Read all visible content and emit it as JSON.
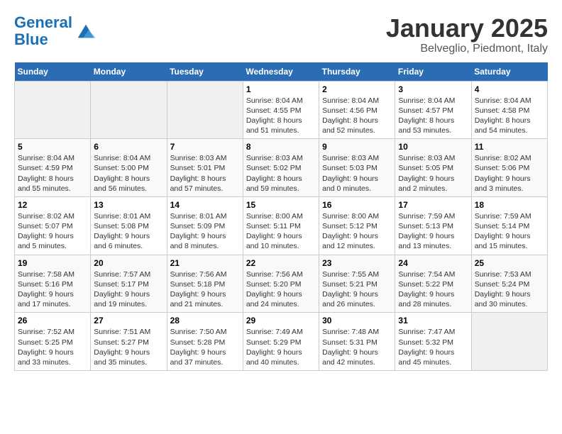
{
  "logo": {
    "line1": "General",
    "line2": "Blue"
  },
  "title": "January 2025",
  "location": "Belveglio, Piedmont, Italy",
  "days_of_week": [
    "Sunday",
    "Monday",
    "Tuesday",
    "Wednesday",
    "Thursday",
    "Friday",
    "Saturday"
  ],
  "weeks": [
    [
      {
        "day": "",
        "info": ""
      },
      {
        "day": "",
        "info": ""
      },
      {
        "day": "",
        "info": ""
      },
      {
        "day": "1",
        "info": "Sunrise: 8:04 AM\nSunset: 4:55 PM\nDaylight: 8 hours and 51 minutes."
      },
      {
        "day": "2",
        "info": "Sunrise: 8:04 AM\nSunset: 4:56 PM\nDaylight: 8 hours and 52 minutes."
      },
      {
        "day": "3",
        "info": "Sunrise: 8:04 AM\nSunset: 4:57 PM\nDaylight: 8 hours and 53 minutes."
      },
      {
        "day": "4",
        "info": "Sunrise: 8:04 AM\nSunset: 4:58 PM\nDaylight: 8 hours and 54 minutes."
      }
    ],
    [
      {
        "day": "5",
        "info": "Sunrise: 8:04 AM\nSunset: 4:59 PM\nDaylight: 8 hours and 55 minutes."
      },
      {
        "day": "6",
        "info": "Sunrise: 8:04 AM\nSunset: 5:00 PM\nDaylight: 8 hours and 56 minutes."
      },
      {
        "day": "7",
        "info": "Sunrise: 8:03 AM\nSunset: 5:01 PM\nDaylight: 8 hours and 57 minutes."
      },
      {
        "day": "8",
        "info": "Sunrise: 8:03 AM\nSunset: 5:02 PM\nDaylight: 8 hours and 59 minutes."
      },
      {
        "day": "9",
        "info": "Sunrise: 8:03 AM\nSunset: 5:03 PM\nDaylight: 9 hours and 0 minutes."
      },
      {
        "day": "10",
        "info": "Sunrise: 8:03 AM\nSunset: 5:05 PM\nDaylight: 9 hours and 2 minutes."
      },
      {
        "day": "11",
        "info": "Sunrise: 8:02 AM\nSunset: 5:06 PM\nDaylight: 9 hours and 3 minutes."
      }
    ],
    [
      {
        "day": "12",
        "info": "Sunrise: 8:02 AM\nSunset: 5:07 PM\nDaylight: 9 hours and 5 minutes."
      },
      {
        "day": "13",
        "info": "Sunrise: 8:01 AM\nSunset: 5:08 PM\nDaylight: 9 hours and 6 minutes."
      },
      {
        "day": "14",
        "info": "Sunrise: 8:01 AM\nSunset: 5:09 PM\nDaylight: 9 hours and 8 minutes."
      },
      {
        "day": "15",
        "info": "Sunrise: 8:00 AM\nSunset: 5:11 PM\nDaylight: 9 hours and 10 minutes."
      },
      {
        "day": "16",
        "info": "Sunrise: 8:00 AM\nSunset: 5:12 PM\nDaylight: 9 hours and 12 minutes."
      },
      {
        "day": "17",
        "info": "Sunrise: 7:59 AM\nSunset: 5:13 PM\nDaylight: 9 hours and 13 minutes."
      },
      {
        "day": "18",
        "info": "Sunrise: 7:59 AM\nSunset: 5:14 PM\nDaylight: 9 hours and 15 minutes."
      }
    ],
    [
      {
        "day": "19",
        "info": "Sunrise: 7:58 AM\nSunset: 5:16 PM\nDaylight: 9 hours and 17 minutes."
      },
      {
        "day": "20",
        "info": "Sunrise: 7:57 AM\nSunset: 5:17 PM\nDaylight: 9 hours and 19 minutes."
      },
      {
        "day": "21",
        "info": "Sunrise: 7:56 AM\nSunset: 5:18 PM\nDaylight: 9 hours and 21 minutes."
      },
      {
        "day": "22",
        "info": "Sunrise: 7:56 AM\nSunset: 5:20 PM\nDaylight: 9 hours and 24 minutes."
      },
      {
        "day": "23",
        "info": "Sunrise: 7:55 AM\nSunset: 5:21 PM\nDaylight: 9 hours and 26 minutes."
      },
      {
        "day": "24",
        "info": "Sunrise: 7:54 AM\nSunset: 5:22 PM\nDaylight: 9 hours and 28 minutes."
      },
      {
        "day": "25",
        "info": "Sunrise: 7:53 AM\nSunset: 5:24 PM\nDaylight: 9 hours and 30 minutes."
      }
    ],
    [
      {
        "day": "26",
        "info": "Sunrise: 7:52 AM\nSunset: 5:25 PM\nDaylight: 9 hours and 33 minutes."
      },
      {
        "day": "27",
        "info": "Sunrise: 7:51 AM\nSunset: 5:27 PM\nDaylight: 9 hours and 35 minutes."
      },
      {
        "day": "28",
        "info": "Sunrise: 7:50 AM\nSunset: 5:28 PM\nDaylight: 9 hours and 37 minutes."
      },
      {
        "day": "29",
        "info": "Sunrise: 7:49 AM\nSunset: 5:29 PM\nDaylight: 9 hours and 40 minutes."
      },
      {
        "day": "30",
        "info": "Sunrise: 7:48 AM\nSunset: 5:31 PM\nDaylight: 9 hours and 42 minutes."
      },
      {
        "day": "31",
        "info": "Sunrise: 7:47 AM\nSunset: 5:32 PM\nDaylight: 9 hours and 45 minutes."
      },
      {
        "day": "",
        "info": ""
      }
    ]
  ]
}
